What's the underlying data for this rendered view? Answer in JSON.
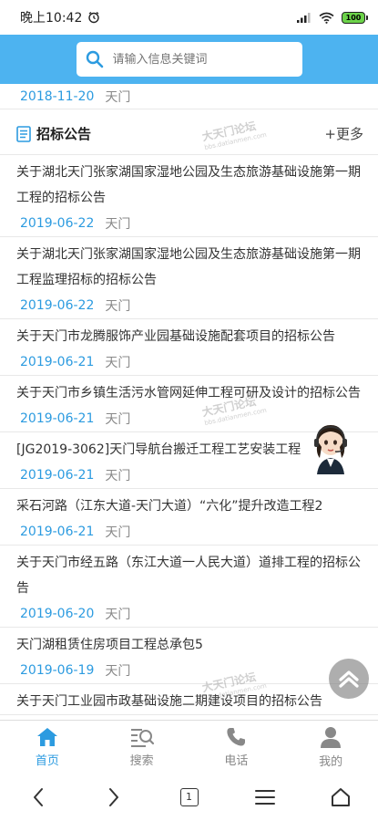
{
  "status": {
    "time": "晚上10:42",
    "battery": "100"
  },
  "search": {
    "placeholder": "请输入信息关键词"
  },
  "top_item": {
    "date": "2018-11-20",
    "place": "天门"
  },
  "section": {
    "title": "招标公告",
    "more": "+更多"
  },
  "watermark": {
    "text": "大天门论坛",
    "url": "bbs.datianmen.com"
  },
  "items": [
    {
      "title": "关于湖北天门张家湖国家湿地公园及生态旅游基础设施第一期工程的招标公告",
      "date": "2019-06-22",
      "place": "天门"
    },
    {
      "title": "关于湖北天门张家湖国家湿地公园及生态旅游基础设施第一期工程监理招标的招标公告",
      "date": "2019-06-22",
      "place": "天门"
    },
    {
      "title": "关于天门市龙腾服饰产业园基础设施配套项目的招标公告",
      "date": "2019-06-21",
      "place": "天门"
    },
    {
      "title": "关于天门市乡镇生活污水管网延伸工程可研及设计的招标公告",
      "date": "2019-06-21",
      "place": "天门"
    },
    {
      "title": "[JG2019-3062]天门导航台搬迁工程工艺安装工程",
      "date": "2019-06-21",
      "place": "天门"
    },
    {
      "title": "采石河路（江东大道-天门大道）“六化”提升改造工程2",
      "date": "2019-06-21",
      "place": "天门"
    },
    {
      "title": "关于天门市经五路（东江大道一人民大道）道排工程的招标公告",
      "date": "2019-06-20",
      "place": "天门"
    },
    {
      "title": "天门湖租赁住房项目工程总承包5",
      "date": "2019-06-19",
      "place": "天门"
    },
    {
      "title": "关于天门工业园市政基础设施二期建设项目的招标公告",
      "date": "",
      "place": ""
    }
  ],
  "nav": {
    "home": "首页",
    "search": "搜索",
    "phone": "电话",
    "mine": "我的"
  },
  "sys": {
    "tabs_count": "1"
  },
  "colors": {
    "accent": "#4db3f0",
    "date": "#2c9be0"
  }
}
